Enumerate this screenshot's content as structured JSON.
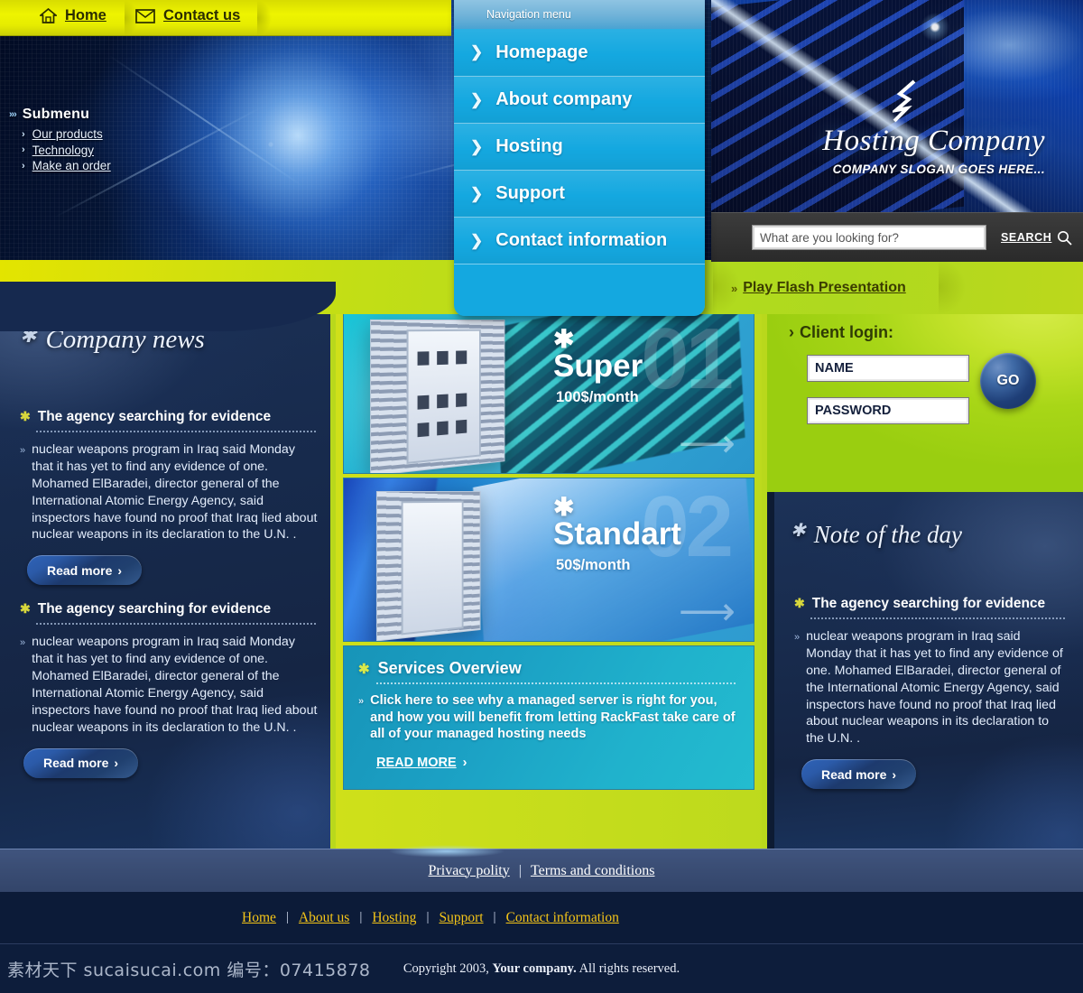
{
  "topnav": {
    "items": [
      {
        "label": "Home",
        "icon": "home-icon"
      },
      {
        "label": "Contact us",
        "icon": "envelope-icon"
      }
    ]
  },
  "submenu": {
    "title": "Submenu",
    "links": [
      "Our products",
      "Technology",
      "Make an order"
    ]
  },
  "navmenu": {
    "header": "Navigation menu",
    "items": [
      "Homepage",
      "About company",
      "Hosting",
      "Support",
      "Contact information"
    ]
  },
  "brand": {
    "name": "Hosting Company",
    "slogan": "COMPANY SLOGAN GOES HERE..."
  },
  "search": {
    "placeholder": "What are you looking for?",
    "value": "",
    "button_label": "SEARCH"
  },
  "flash": {
    "label": "Play Flash Presentation",
    "chevron": "»"
  },
  "news": {
    "title": "Company news",
    "items": [
      {
        "heading": "The agency searching for evidence",
        "body": "nuclear weapons program in Iraq said Monday that it has yet to find any evidence of one. Mohamed ElBaradei, director general of the International Atomic Energy Agency, said inspectors have found no proof that Iraq lied about nuclear weapons in its declaration to the U.N. .",
        "read_more": "Read more"
      },
      {
        "heading": "The agency searching for evidence",
        "body": "nuclear weapons program in Iraq said Monday that it has yet to find any evidence of one. Mohamed ElBaradei, director general of the International Atomic Energy Agency, said inspectors have found no proof that Iraq lied about nuclear weapons in its declaration to the U.N. .",
        "read_more": "Read more"
      }
    ]
  },
  "plans": [
    {
      "num": "01",
      "name": "Super",
      "price": "100$/month"
    },
    {
      "num": "02",
      "name": "Standart",
      "price": "50$/month"
    }
  ],
  "services": {
    "heading": "Services Overview",
    "body": "Click here to see why a managed server is right for you, and how you will benefit from letting RackFast take care of all of your managed hosting needs",
    "read_more": "READ MORE"
  },
  "login": {
    "title": "Client login:",
    "name_value": "NAME",
    "password_value": "PASSWORD",
    "go_label": "GO"
  },
  "note": {
    "title": "Note of the day",
    "heading": "The agency searching for evidence",
    "body": "nuclear weapons program in Iraq said Monday that it has yet to find any evidence of one. Mohamed ElBaradei, director general of the International Atomic Energy Agency, said inspectors have found no proof that Iraq lied about nuclear weapons in its declaration to the U.N. .",
    "read_more": "Read more"
  },
  "footer": {
    "legal": [
      "Privacy polity",
      "Terms and conditions"
    ],
    "nav": [
      "Home",
      "About us",
      "Hosting",
      "Support",
      "Contact information"
    ],
    "copyright_prefix": "Copyright 2003, ",
    "copyright_company": "Your company.",
    "copyright_suffix": " All rights reserved.",
    "watermark": "素材天下 sucaisucai.com  编号：07415878"
  },
  "colors": {
    "yellow": "#e6ec00",
    "green": "#b9d81c",
    "cyan": "#14a8e0",
    "navy": "#16294f",
    "footer_gold": "#f5c518"
  }
}
